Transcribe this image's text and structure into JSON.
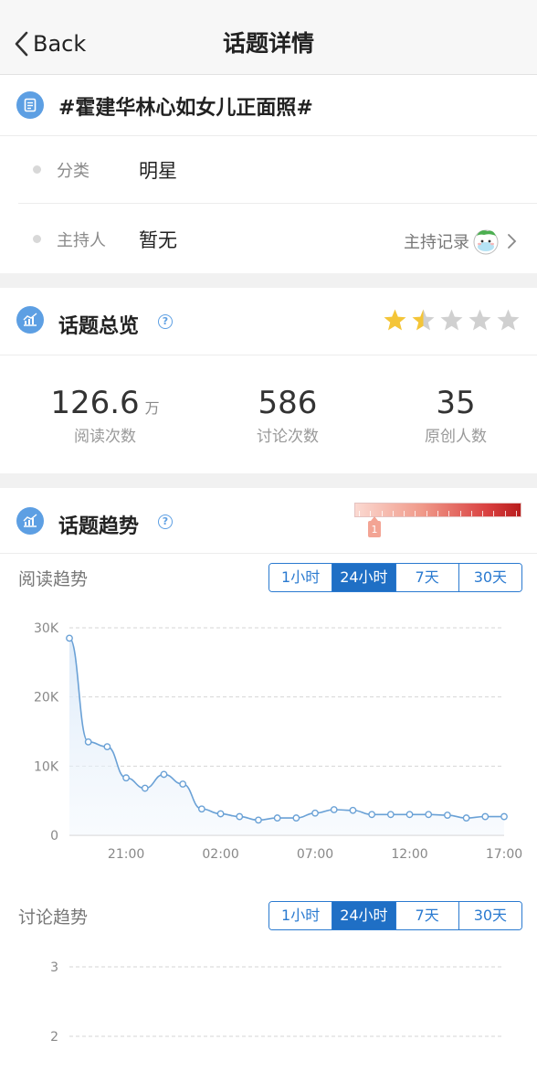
{
  "nav": {
    "back_label": "Back",
    "title": "话题详情"
  },
  "topic": {
    "name": "#霍建华林心如女儿正面照#"
  },
  "info": {
    "category_key": "分类",
    "category_value": "明星",
    "host_key": "主持人",
    "host_value": "暂无",
    "host_record_label": "主持记录"
  },
  "overview": {
    "title": "话题总览",
    "rating": 1.5,
    "rating_max": 5,
    "stats": [
      {
        "value": "126.6",
        "unit": "万",
        "label": "阅读次数"
      },
      {
        "value": "586",
        "unit": "",
        "label": "讨论次数"
      },
      {
        "value": "35",
        "unit": "",
        "label": "原创人数"
      }
    ]
  },
  "trend": {
    "title": "话题趋势",
    "heat_level": "1",
    "reading_title": "阅读趋势",
    "discussion_title": "讨论趋势",
    "ranges": [
      "1小时",
      "24小时",
      "7天",
      "30天"
    ],
    "active_range": "24小时"
  },
  "colors": {
    "accent": "#1f6fc5",
    "icon_blue": "#5d9fe3",
    "star_gold": "#f4c538",
    "star_gray": "#d0d0d0",
    "line": "#6aa1d6"
  },
  "chart_data": [
    {
      "type": "area",
      "title": "阅读趋势",
      "yticks": [
        "30K",
        "20K",
        "10K",
        "0"
      ],
      "ylim": [
        0,
        30000
      ],
      "xticks": [
        "21:00",
        "02:00",
        "07:00",
        "12:00",
        "17:00"
      ],
      "grid": true,
      "x": [
        "18:00",
        "19:00",
        "20:00",
        "21:00",
        "22:00",
        "23:00",
        "00:00",
        "01:00",
        "02:00",
        "03:00",
        "04:00",
        "05:00",
        "06:00",
        "07:00",
        "08:00",
        "09:00",
        "10:00",
        "11:00",
        "12:00",
        "13:00",
        "14:00",
        "15:00",
        "16:00",
        "17:00"
      ],
      "values": [
        28500,
        13500,
        12800,
        8300,
        6800,
        8800,
        7400,
        3800,
        3100,
        2700,
        2200,
        2500,
        2500,
        3200,
        3700,
        3600,
        3000,
        3000,
        3000,
        3000,
        2900,
        2500,
        2700,
        2700
      ]
    },
    {
      "type": "line",
      "title": "讨论趋势",
      "yticks": [
        "3",
        "2"
      ],
      "grid": true,
      "values": []
    }
  ]
}
